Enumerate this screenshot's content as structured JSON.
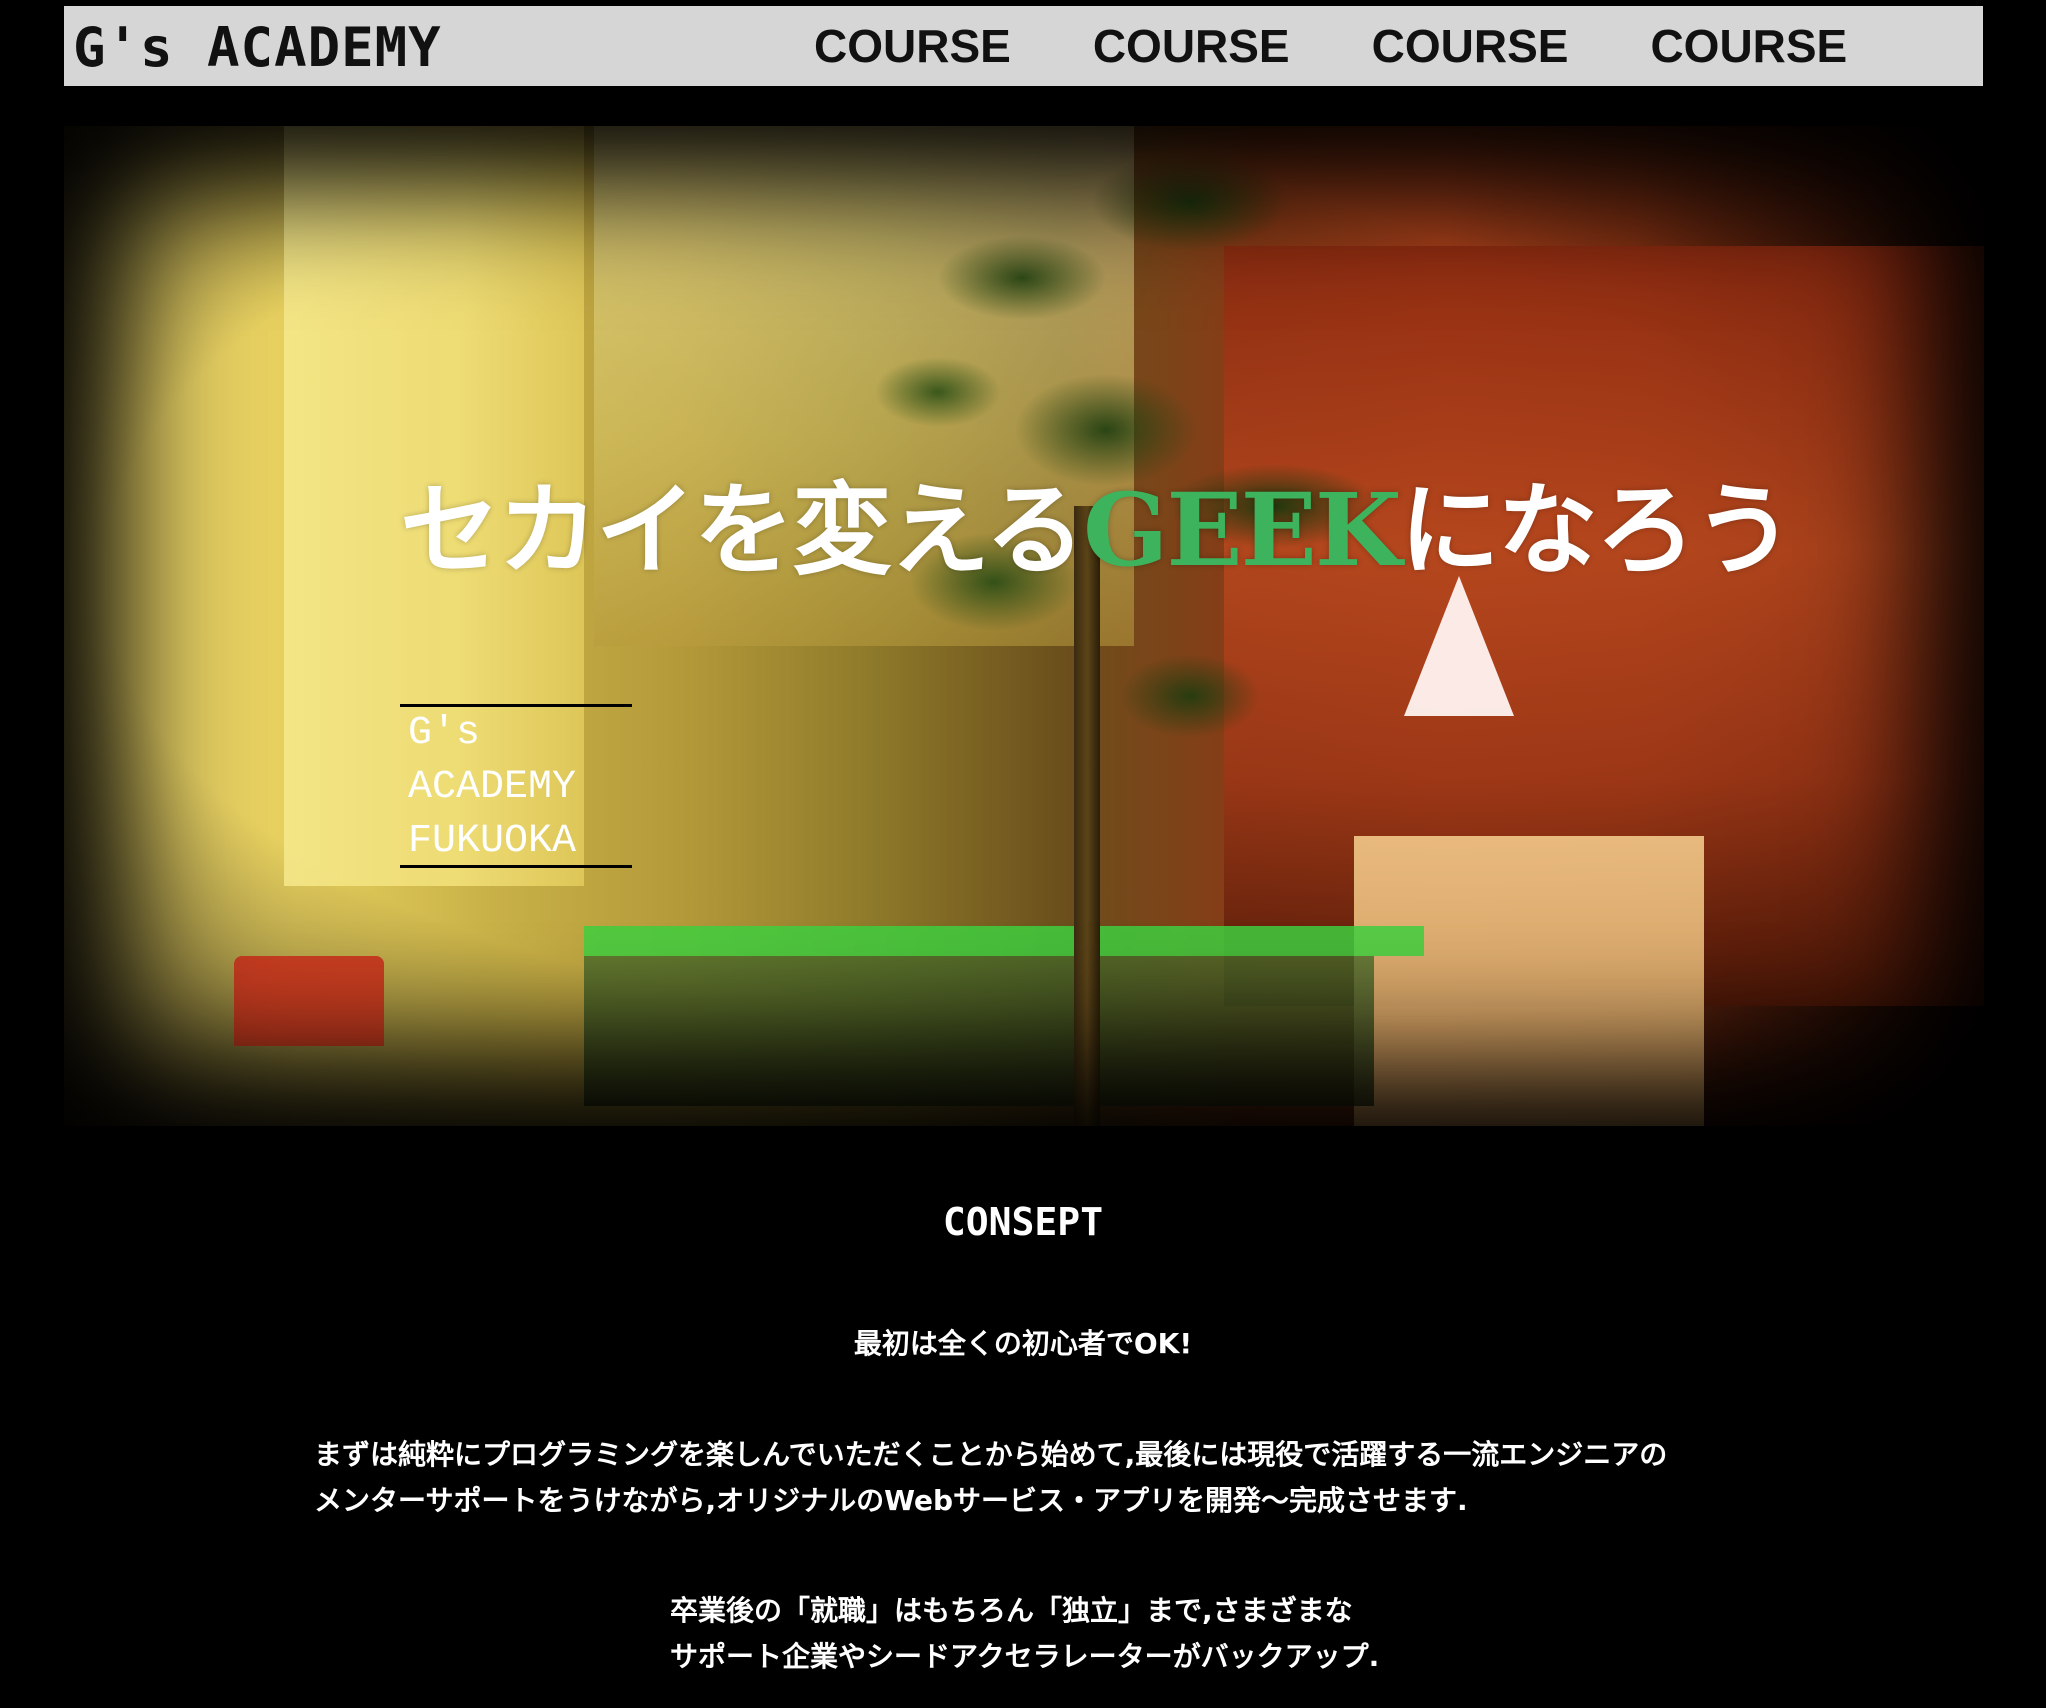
{
  "header": {
    "logo": "G's ACADEMY",
    "nav": [
      "COURSE",
      "COURSE",
      "COURSE",
      "COURSE"
    ]
  },
  "hero": {
    "title_before": "セカイを変える",
    "title_highlight": "GEEK",
    "title_after": "になろう",
    "badge_lines": [
      "G's",
      "ACADEMY",
      "FUKUOKA"
    ]
  },
  "concept": {
    "title": "CONSEPT",
    "lead": "最初は全くの初心者でOK!",
    "body_lines": [
      "まずは純粋にプログラミングを楽しんでいただくことから始めて,最後には現役で活躍する一流エンジニアの",
      "メンターサポートをうけながら,オリジナルのWebサービス・アプリを開発〜完成させます."
    ],
    "support_lines": [
      "卒業後の「就職」はもちろん「独立」まで,さまざまな",
      "サポート企業やシードアクセラレーターがバックアップ."
    ]
  },
  "colors": {
    "header_bg": "#d6d6d6",
    "page_bg": "#000000",
    "accent_green": "#3db35e",
    "text": "#ffffff"
  }
}
